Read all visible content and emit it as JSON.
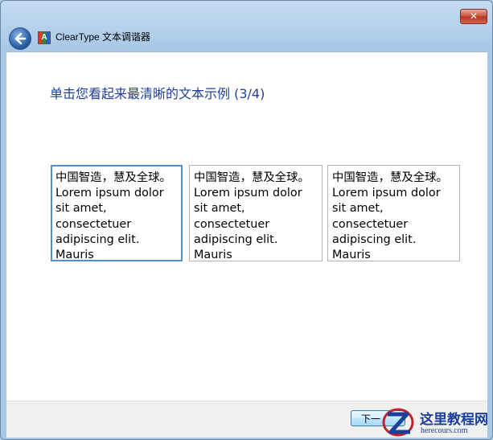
{
  "window": {
    "title": "ClearType 文本调谐器",
    "close_label": "✕",
    "app_icon_letter": "A"
  },
  "main": {
    "heading": "单击您看起来最清晰的文本示例 (3/4)",
    "samples": [
      {
        "text": "中国智造，慧及全球。Lorem ipsum dolor sit amet, consectetuer adipiscing elit. Mauris",
        "selected": true
      },
      {
        "text": "中国智造，慧及全球。Lorem ipsum dolor sit amet, consectetuer adipiscing elit. Mauris",
        "selected": false
      },
      {
        "text": "中国智造，慧及全球。Lorem ipsum dolor sit amet, consectetuer adipiscing elit. Mauris",
        "selected": false
      }
    ]
  },
  "footer": {
    "next_label": "下一"
  },
  "watermark": {
    "name": "这里教程网",
    "url": "herecours.com"
  }
}
